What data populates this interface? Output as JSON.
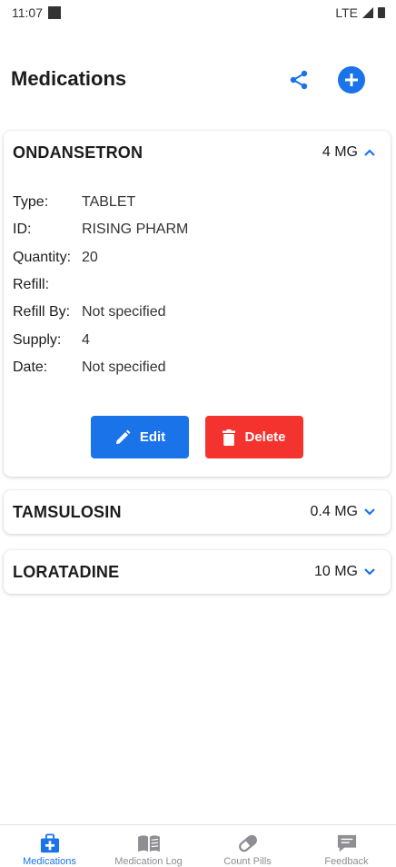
{
  "status_bar": {
    "time": "11:07",
    "network": "LTE"
  },
  "header": {
    "title": "Medications"
  },
  "medications": [
    {
      "name": "ONDANSETRON",
      "dose": "4 MG",
      "expanded": true,
      "details": [
        {
          "label": "Type:",
          "value": "TABLET"
        },
        {
          "label": "ID:",
          "value": "RISING PHARM"
        },
        {
          "label": "Quantity:",
          "value": "20"
        },
        {
          "label": "Refill:",
          "value": ""
        },
        {
          "label": "Refill By:",
          "value": "Not specified"
        },
        {
          "label": "Supply:",
          "value": "4"
        },
        {
          "label": "Date:",
          "value": "Not specified"
        }
      ],
      "edit_label": "Edit",
      "delete_label": "Delete"
    },
    {
      "name": "TAMSULOSIN",
      "dose": "0.4 MG",
      "expanded": false
    },
    {
      "name": "LORATADINE",
      "dose": "10 MG",
      "expanded": false
    }
  ],
  "bottom_nav": [
    {
      "label": "Medications",
      "icon": "medkit-icon",
      "active": true
    },
    {
      "label": "Medication Log",
      "icon": "book-icon",
      "active": false
    },
    {
      "label": "Count Pills",
      "icon": "pill-icon",
      "active": false
    },
    {
      "label": "Feedback",
      "icon": "feedback-icon",
      "active": false
    }
  ],
  "colors": {
    "accent": "#1a73e8",
    "danger": "#f4332e",
    "text": "#1c1c1e",
    "muted": "#8e8e93"
  }
}
